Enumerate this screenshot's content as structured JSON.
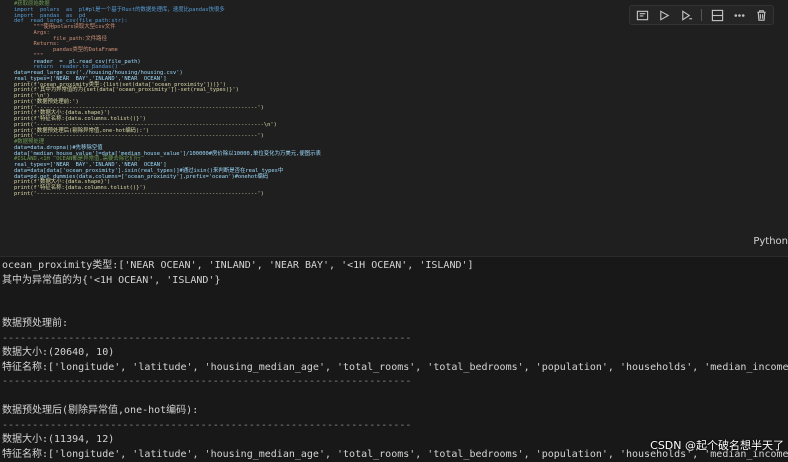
{
  "code_lines": [
    "#获取原始数据",
    "import  polars  as  pl#pl是一个基于Rust的数据处理库，速度比pandas快很多",
    "import  pandas  as  pd",
    "def  read_large_csv(file_path:str):",
    "      \"\"\"使用polars读取大型csv文件",
    "      Args:",
    "            file_path:文件路径",
    "      Returns:",
    "            pandas类型的DataFrame",
    "      \"\"\"",
    "      reader  =  pl.read_csv(file_path)",
    "      return  reader.to_pandas()",
    "data=read_large_csv('./housing/housing/housing.csv')",
    "real_types=['NEAR  BAY','INLAND','NEAR  OCEAN']",
    "print(f'ocean_proximity类型:{list(set(data['ocean_proximity']))}')",
    "print(f'其中为异常值的为{set(data['ocean_proximity'])-set(real_types)}')",
    "print('\\n')",
    "print('数据预处理前:')",
    "print('--------------------------------------------------------------------')",
    "print(f'数据大小:{data.shape}')",
    "print(f'特征名称:{data.columns.tolist()}')",
    "print('----------------------------------------------------------------------\\n')",
    "print('数据预处理后(剔除异常值,one-hot编码):')",
    "print('--------------------------------------------------------------------')",
    "#数据预处理",
    "data=data.dropna()#先移除空值",
    "data['median_house_value']=data['median_house_value']/100000#房价除以10000,单位变化为万美元,便图示表",
    "#ISLAND,<1H  OCEAN都是异常值,需要去除它们行",
    "real_types=['NEAR  BAY','INLAND','NEAR  OCEAN']",
    "data=data[data['ocean_proximity'].isin(real_types)]#通过isin()来判断是否在real_types中",
    "data=pd.get_dummies(data,columns=['ocean_proximity'],prefix='ocean')#onehot编码",
    "print(f'数据大小:{data.shape}')",
    "print(f'特征名称:{data.columns.tolist()}')",
    "print('--------------------------------------------------------------------')"
  ],
  "cell_language": "Python",
  "toolbar": {
    "run_by_line_icon": "run-by-line-icon",
    "execute_above_icon": "execute-above-icon",
    "execute_below_icon": "execute-below-icon",
    "split_cell_icon": "split-cell-icon",
    "more_icon": "more-icon",
    "delete_icon": "delete-icon"
  },
  "output_lines": [
    "ocean_proximity类型:['NEAR OCEAN', 'INLAND', 'NEAR BAY', '<1H OCEAN', 'ISLAND']",
    "其中为异常值的为{'<1H OCEAN', 'ISLAND'}",
    "",
    "",
    "数据预处理前:",
    "--------------------------------------------------------------------",
    "数据大小:(20640, 10)",
    "特征名称:['longitude', 'latitude', 'housing_median_age', 'total_rooms', 'total_bedrooms', 'population', 'households', 'median_income', 'median_house_value', 'ocean_proximity']",
    "--------------------------------------------------------------------",
    "",
    "数据预处理后(剔除异常值,one-hot编码):",
    "--------------------------------------------------------------------",
    "数据大小:(11394, 12)",
    "特征名称:['longitude', 'latitude', 'housing_median_age', 'total_rooms', 'total_bedrooms', 'population', 'households', 'median_income', 'median_house_value', 'ocean_INLAND', 'ocean_NEAR BAY', 'ocean_NEAR OCEAN']"
  ],
  "watermark": "CSDN @起个破名想半天了"
}
